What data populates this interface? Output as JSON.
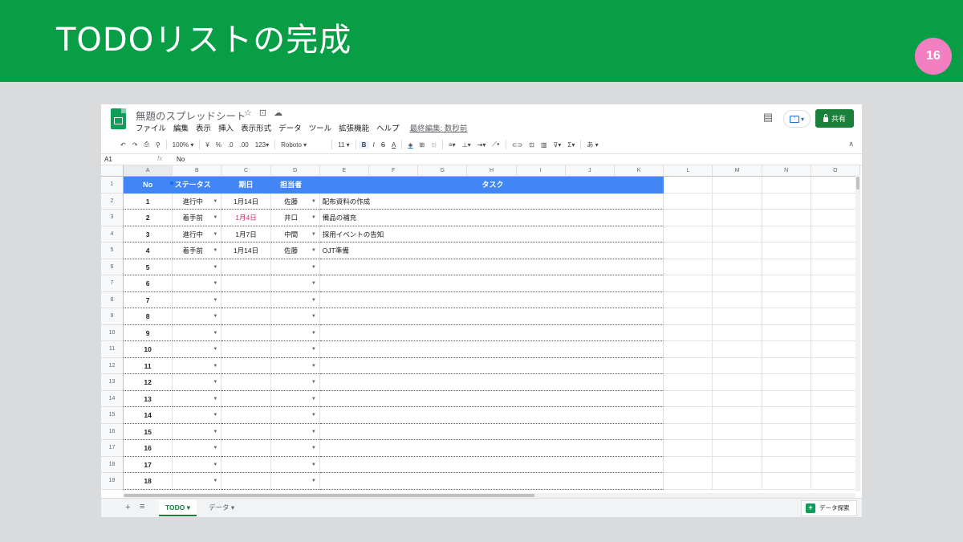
{
  "slide": {
    "title": "TODOリストの完成",
    "page_number": "16",
    "colors": {
      "header_bg": "#079e46",
      "badge_bg": "#f27fc2",
      "body_bg": "#d9dbdc"
    }
  },
  "app": {
    "doc_title": "無題のスプレッドシート",
    "title_icons": [
      "☆",
      "⊡",
      "☁"
    ],
    "menu": [
      "ファイル",
      "編集",
      "表示",
      "挿入",
      "表示形式",
      "データ",
      "ツール",
      "拡張機能",
      "ヘルプ"
    ],
    "last_edit": "最終編集: 数秒前",
    "share_label": "共有",
    "present_icon": "present-icon",
    "accent_color": "#188038",
    "header_fill": "#4285f4"
  },
  "toolbar": {
    "undo": "↶",
    "redo": "↷",
    "print": "⎙",
    "paint_format": "⚲",
    "zoom": "100% ▾",
    "currency": "¥",
    "percent": "%",
    "dec_decrease": ".0",
    "dec_increase": ".00",
    "more_formats": "123▾",
    "font": "Roboto ▾",
    "font_size": "11 ▾",
    "bold": "B",
    "italic": "I",
    "strike": "S",
    "text_color": "A",
    "fill": "◈",
    "borders": "⊞",
    "merge": "⊟",
    "halign": "≡▾",
    "valign": "⊥▾",
    "wrap": "⇥▾",
    "rotate": "⟋▾",
    "link": "⊂⊃",
    "comment": "⊡",
    "chart": "▥",
    "filter": "⊽▾",
    "functions": "Σ▾",
    "input_tool": "あ ▾",
    "collapse": "∧"
  },
  "formula_bar": {
    "cell_ref": "A1",
    "fx": "fx",
    "value": "No"
  },
  "grid": {
    "columns": [
      "A",
      "B",
      "C",
      "D",
      "E",
      "F",
      "G",
      "H",
      "I",
      "J",
      "K",
      "L",
      "M",
      "N",
      "O"
    ],
    "row_numbers": [
      "1",
      "2",
      "3",
      "4",
      "5",
      "6",
      "7",
      "8",
      "9",
      "10",
      "11",
      "12",
      "13",
      "14",
      "15",
      "16",
      "17",
      "18",
      "19"
    ],
    "header": {
      "no": "No",
      "status": "ステータス",
      "due": "期日",
      "assignee": "担当者",
      "task": "タスク"
    },
    "rows": [
      {
        "no": "1",
        "status": "進行中",
        "due": "1月14日",
        "due_overdue": false,
        "assignee": "佐藤",
        "task": "配布資料の作成"
      },
      {
        "no": "2",
        "status": "着手前",
        "due": "1月4日",
        "due_overdue": true,
        "assignee": "井口",
        "task": "備品の補充"
      },
      {
        "no": "3",
        "status": "進行中",
        "due": "1月7日",
        "due_overdue": false,
        "assignee": "中間",
        "task": "採用イベントの告知"
      },
      {
        "no": "4",
        "status": "着手前",
        "due": "1月14日",
        "due_overdue": false,
        "assignee": "佐藤",
        "task": "OJT準備"
      },
      {
        "no": "5",
        "status": "",
        "due": "",
        "due_overdue": false,
        "assignee": "",
        "task": ""
      },
      {
        "no": "6",
        "status": "",
        "due": "",
        "due_overdue": false,
        "assignee": "",
        "task": ""
      },
      {
        "no": "7",
        "status": "",
        "due": "",
        "due_overdue": false,
        "assignee": "",
        "task": ""
      },
      {
        "no": "8",
        "status": "",
        "due": "",
        "due_overdue": false,
        "assignee": "",
        "task": ""
      },
      {
        "no": "9",
        "status": "",
        "due": "",
        "due_overdue": false,
        "assignee": "",
        "task": ""
      },
      {
        "no": "10",
        "status": "",
        "due": "",
        "due_overdue": false,
        "assignee": "",
        "task": ""
      },
      {
        "no": "11",
        "status": "",
        "due": "",
        "due_overdue": false,
        "assignee": "",
        "task": ""
      },
      {
        "no": "12",
        "status": "",
        "due": "",
        "due_overdue": false,
        "assignee": "",
        "task": ""
      },
      {
        "no": "13",
        "status": "",
        "due": "",
        "due_overdue": false,
        "assignee": "",
        "task": ""
      },
      {
        "no": "14",
        "status": "",
        "due": "",
        "due_overdue": false,
        "assignee": "",
        "task": ""
      },
      {
        "no": "15",
        "status": "",
        "due": "",
        "due_overdue": false,
        "assignee": "",
        "task": ""
      },
      {
        "no": "16",
        "status": "",
        "due": "",
        "due_overdue": false,
        "assignee": "",
        "task": ""
      },
      {
        "no": "17",
        "status": "",
        "due": "",
        "due_overdue": false,
        "assignee": "",
        "task": ""
      },
      {
        "no": "18",
        "status": "",
        "due": "",
        "due_overdue": false,
        "assignee": "",
        "task": ""
      }
    ],
    "overdue_color": "#e91e63"
  },
  "tabs": {
    "add_icon": "+",
    "list_icon": "≡",
    "items": [
      {
        "label": "TODO ▾",
        "active": true
      },
      {
        "label": "データ ▾",
        "active": false
      }
    ],
    "explore_label": "データ探索",
    "explore_icon": "+"
  }
}
